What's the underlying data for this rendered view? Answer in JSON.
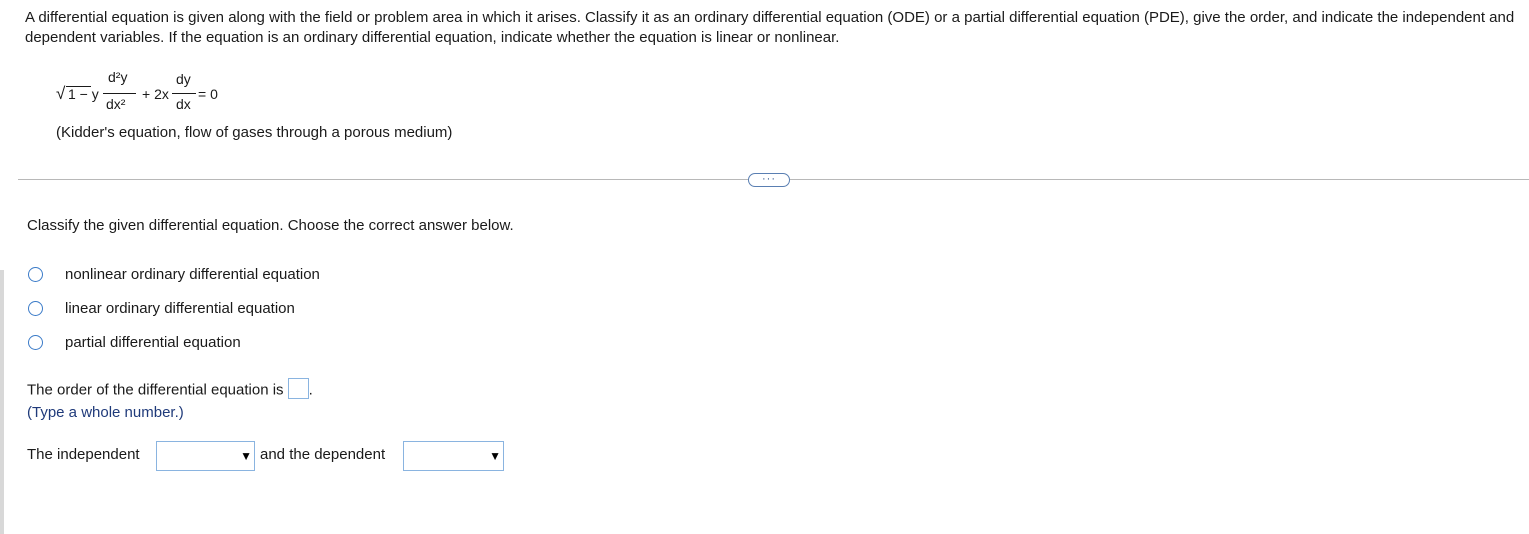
{
  "intro_text": "A differential equation is given along with the field or problem area in which it arises. Classify it as an ordinary differential equation (ODE) or a partial differential equation (PDE), give the order, and indicate the independent and dependent variables. If the equation is an ordinary differential equation, indicate whether the equation is linear or nonlinear.",
  "equation": {
    "sqrt_symbol": "√",
    "radicand": "1 − y",
    "d2y": "d²y",
    "dx2": "dx²",
    "plus_2x": "+ 2x",
    "dy": "dy",
    "dx": "dx",
    "equals_zero": "= 0"
  },
  "source_text": "(Kidder's equation, flow of gases through a porous medium)",
  "more_button_label": "···",
  "question_text": "Classify the given differential equation. Choose the correct answer below.",
  "choices": [
    "nonlinear ordinary differential equation",
    "linear ordinary differential equation",
    "partial differential equation"
  ],
  "order_prompt": "The order of the differential equation is",
  "order_value": "",
  "order_suffix": ".",
  "order_hint": "(Type a whole number.)",
  "independent_label": "The independent",
  "independent_value": "",
  "dependent_label": "and the dependent",
  "dependent_value": "",
  "dropdown_arrow": "▼"
}
